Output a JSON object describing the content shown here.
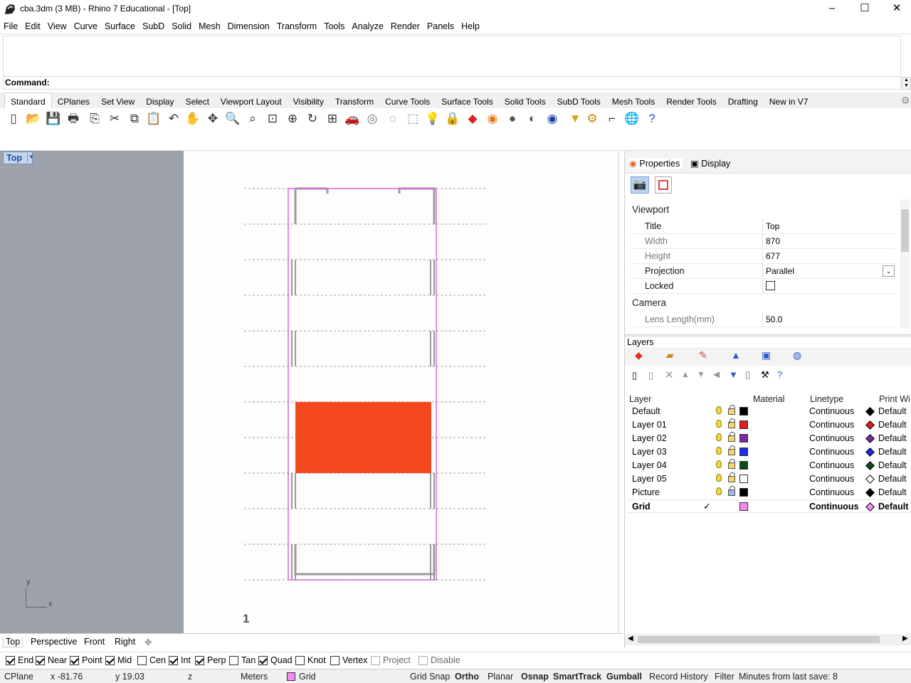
{
  "window": {
    "title": "cba.3dm (3 MB) - Rhino 7 Educational - [Top]",
    "minimize_glyph": "–",
    "maximize_glyph": "☐",
    "close_glyph": "✕"
  },
  "menu": [
    "File",
    "Edit",
    "View",
    "Curve",
    "Surface",
    "SubD",
    "Solid",
    "Mesh",
    "Dimension",
    "Transform",
    "Tools",
    "Analyze",
    "Render",
    "Panels",
    "Help"
  ],
  "command": {
    "label": "Command:"
  },
  "toolbar_tabs": [
    "Standard",
    "CPlanes",
    "Set View",
    "Display",
    "Select",
    "Viewport Layout",
    "Visibility",
    "Transform",
    "Curve Tools",
    "Surface Tools",
    "Solid Tools",
    "SubD Tools",
    "Mesh Tools",
    "Render Tools",
    "Drafting",
    "New in V7"
  ],
  "toolbar_icons": [
    "new-icon",
    "open-icon",
    "save-icon",
    "print-icon",
    "import-icon",
    "cut-icon",
    "copy-icon",
    "paste-icon",
    "undo-icon",
    "pan-icon",
    "rotate-view-icon",
    "zoom-icon",
    "zoom-window-icon",
    "zoom-extents-icon",
    "zoom-selected-icon",
    "rotate-icon",
    "four-viewports-icon",
    "car-icon",
    "object-snap-icon",
    "circle-select-icon",
    "box-select-icon",
    "light-icon",
    "lock-icon",
    "layer-icon",
    "color-wheel-icon",
    "shaded-icon",
    "rendered-icon",
    "blue-sphere-icon",
    "filter-icon",
    "gear-icon",
    "dimension-icon",
    "globe-icon",
    "help-icon"
  ],
  "viewport": {
    "label": "Top",
    "page_number": "1",
    "axis_x": "x",
    "axis_y": "y",
    "tabs": [
      "Top",
      "Perspective",
      "Front",
      "Right"
    ],
    "add_tab": "✥",
    "highlight_color": "#f4491c",
    "frame_color": "#d96bd9"
  },
  "panel": {
    "tabs": [
      "Properties",
      "Display"
    ],
    "sections": {
      "viewport": "Viewport",
      "camera": "Camera"
    },
    "rows": [
      {
        "key": "Title",
        "value": "Top"
      },
      {
        "key": "Width",
        "value": "870"
      },
      {
        "key": "Height",
        "value": "677"
      },
      {
        "key": "Projection",
        "value": "Parallel"
      },
      {
        "key": "Locked",
        "value": ""
      },
      {
        "key": "Lens Length(mm)",
        "value": "50.0"
      }
    ]
  },
  "layers": {
    "title": "Layers",
    "headers": [
      "Layer",
      "Material",
      "Linetype",
      "Print Wi"
    ],
    "rows": [
      {
        "name": "Default",
        "color": "#000000",
        "linetype": "Continuous",
        "print": "Default",
        "diamond": "#000000"
      },
      {
        "name": "Layer 01",
        "color": "#e01b1b",
        "linetype": "Continuous",
        "print": "Default",
        "diamond": "#e01b1b"
      },
      {
        "name": "Layer 02",
        "color": "#7a2aa6",
        "linetype": "Continuous",
        "print": "Default",
        "diamond": "#7a2aa6"
      },
      {
        "name": "Layer 03",
        "color": "#1b2de0",
        "linetype": "Continuous",
        "print": "Default",
        "diamond": "#1b2de0"
      },
      {
        "name": "Layer 04",
        "color": "#0b4d12",
        "linetype": "Continuous",
        "print": "Default",
        "diamond": "#0b4d12"
      },
      {
        "name": "Layer 05",
        "color": "#ffffff",
        "linetype": "Continuous",
        "print": "Default",
        "diamond": "#ffffff"
      },
      {
        "name": "Picture",
        "color": "#000000",
        "linetype": "Continuous",
        "print": "Default",
        "diamond": "#000000"
      },
      {
        "name": "Grid",
        "color": "#f58af5",
        "linetype": "Continuous",
        "print": "Default",
        "diamond": "#f58af5",
        "current": true
      }
    ]
  },
  "osnaps": [
    {
      "label": "End",
      "checked": true
    },
    {
      "label": "Near",
      "checked": true
    },
    {
      "label": "Point",
      "checked": true
    },
    {
      "label": "Mid",
      "checked": true
    },
    {
      "label": "Cen",
      "checked": false
    },
    {
      "label": "Int",
      "checked": true
    },
    {
      "label": "Perp",
      "checked": true
    },
    {
      "label": "Tan",
      "checked": false
    },
    {
      "label": "Quad",
      "checked": true
    },
    {
      "label": "Knot",
      "checked": false
    },
    {
      "label": "Vertex",
      "checked": false
    },
    {
      "label": "Project",
      "checked": false,
      "disabled": true
    },
    {
      "label": "Disable",
      "checked": false,
      "disabled": true
    }
  ],
  "status": {
    "cplane": "CPlane",
    "x": "x -81.76",
    "y": "y 19.03",
    "z": "z",
    "units": "Meters",
    "layer": "Grid",
    "grid_snap": "Grid Snap",
    "ortho": "Ortho",
    "planar": "Planar",
    "osnap": "Osnap",
    "smarttrack": "SmartTrack",
    "gumball": "Gumball",
    "record_history": "Record History",
    "filter": "Filter",
    "minutes": "Minutes from last save: 8"
  }
}
